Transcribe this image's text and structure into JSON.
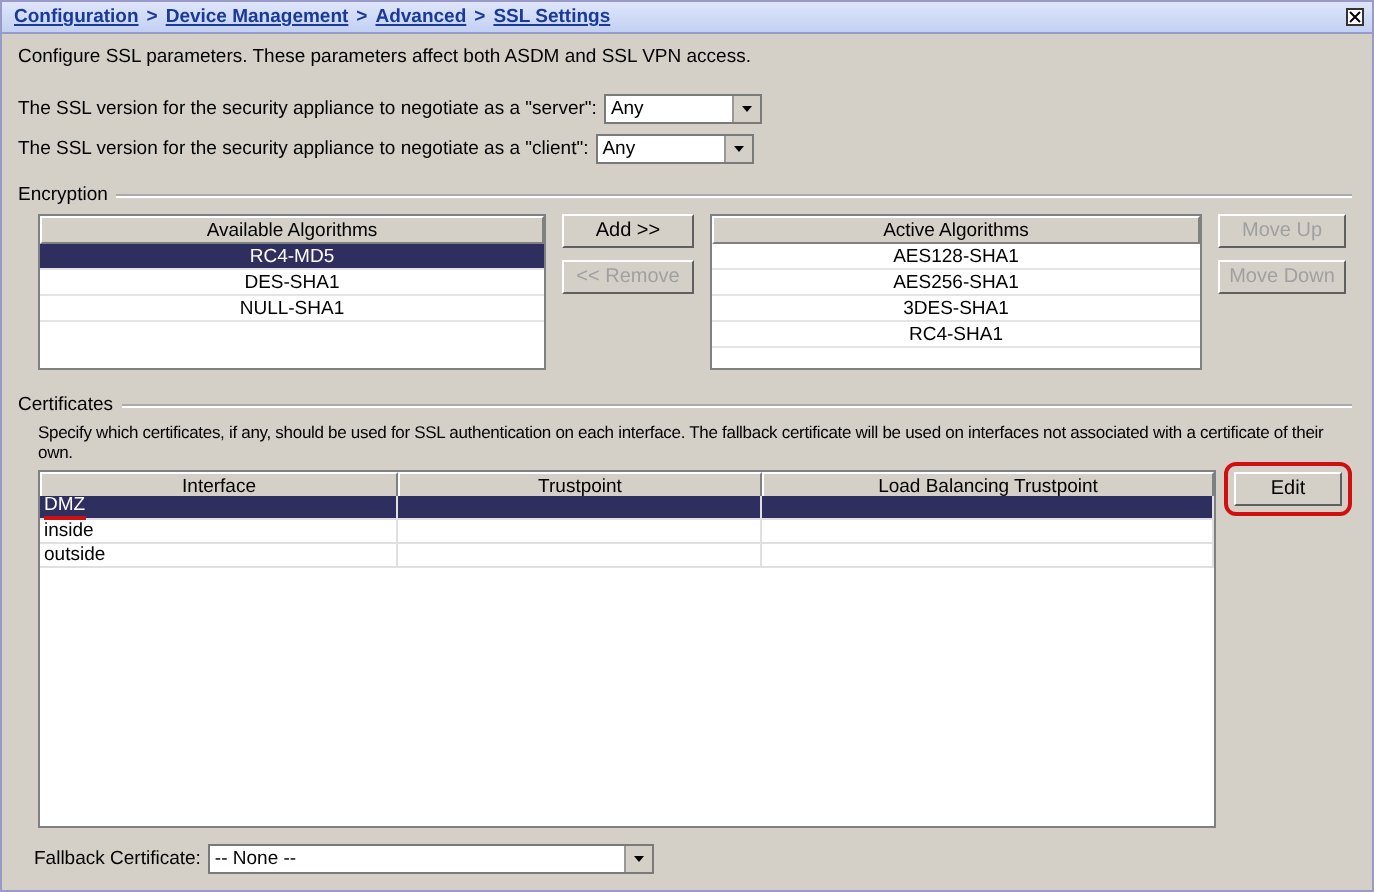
{
  "breadcrumb": [
    {
      "label": "Configuration"
    },
    {
      "label": "Device Management"
    },
    {
      "label": "Advanced"
    },
    {
      "label": "SSL Settings"
    }
  ],
  "breadcrumb_separator": ">",
  "description": "Configure SSL parameters. These parameters affect both ASDM and SSL VPN access.",
  "versions": [
    {
      "label": "The SSL version for the security appliance to negotiate as a \"server\":",
      "value": "Any"
    },
    {
      "label": "The SSL version for the security appliance to negotiate as a \"client\":",
      "value": "Any"
    }
  ],
  "encryption": {
    "title": "Encryption",
    "available": {
      "header": "Available Algorithms",
      "items": [
        {
          "label": "RC4-MD5",
          "selected": true
        },
        {
          "label": "DES-SHA1",
          "selected": false
        },
        {
          "label": "NULL-SHA1",
          "selected": false
        }
      ]
    },
    "middle_buttons": [
      {
        "label": "Add >>",
        "disabled": false
      },
      {
        "label": "<< Remove",
        "disabled": true
      }
    ],
    "active": {
      "header": "Active Algorithms",
      "items": [
        {
          "label": "AES128-SHA1",
          "selected": false
        },
        {
          "label": "AES256-SHA1",
          "selected": false
        },
        {
          "label": "3DES-SHA1",
          "selected": false
        },
        {
          "label": "RC4-SHA1",
          "selected": false
        }
      ]
    },
    "order_buttons": [
      {
        "label": "Move Up",
        "disabled": true
      },
      {
        "label": "Move Down",
        "disabled": true
      }
    ]
  },
  "certificates": {
    "title": "Certificates",
    "description": "Specify which certificates, if any, should be used for SSL authentication on each interface. The fallback certificate will be used on interfaces not associated with a certificate of their own.",
    "columns": [
      "Interface",
      "Trustpoint",
      "Load Balancing Trustpoint"
    ],
    "rows": [
      {
        "interface": "DMZ",
        "selected": true
      },
      {
        "interface": "inside",
        "selected": false
      },
      {
        "interface": "outside",
        "selected": false
      }
    ],
    "edit_button": {
      "label": "Edit",
      "highlighted": true
    }
  },
  "fallback": {
    "label": "Fallback Certificate:",
    "value": "-- None --"
  }
}
